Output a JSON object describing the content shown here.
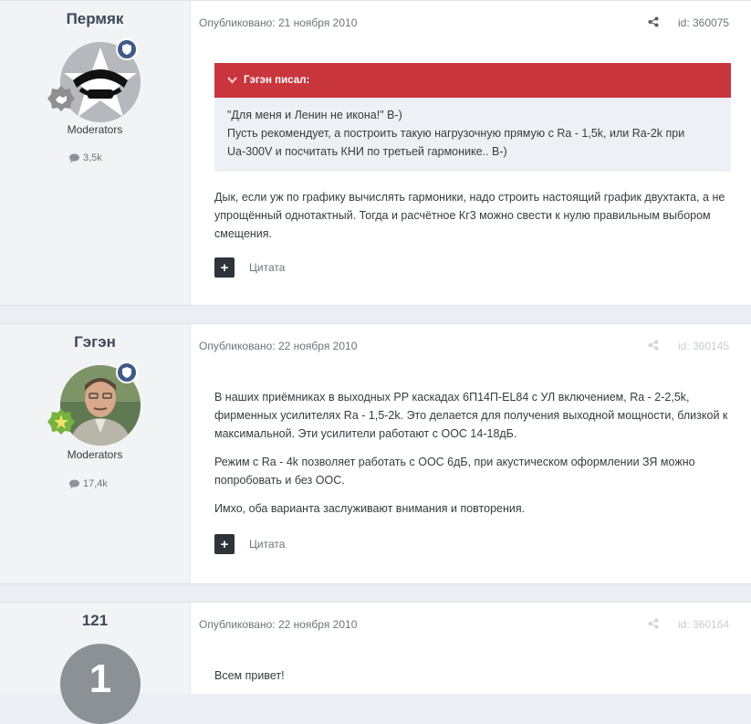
{
  "posts": [
    {
      "author": "Пермяк",
      "group": "Moderators",
      "reputation": "3,5k",
      "date_label": "Опубликовано: 21 ноября 2010",
      "id_label": "id: 360075",
      "quote": {
        "header": "Гэгэн писал:",
        "lines": [
          "\"Для меня и Ленин не икона!\" B-)",
          "Пусть рекомендует, а построить такую нагрузочную прямую с Ra - 1,5k, или Ra-2k при",
          "Ua-300V и посчитать КНИ по третьей гармонике.. B-)"
        ]
      },
      "paragraphs": [
        "Дык, если уж по графику вычислять гармоники, надо строить настоящий график двухтакта, а не упрощённый однотактный. Тогда и расчётное Кг3 можно свести к нулю правильным выбором смещения."
      ],
      "cite_label": "Цитата"
    },
    {
      "author": "Гэгэн",
      "group": "Moderators",
      "reputation": "17,4k",
      "date_label": "Опубликовано: 22 ноября 2010",
      "id_label": "id: 360145",
      "paragraphs": [
        "В наших приёмниках в выходных РР каскадах 6П14П-EL84 с УЛ включением, Ra - 2-2,5k, фирменных усилителях Ra - 1,5-2k. Это делается для получения выходной мощности, близкой к максимальной. Эти усилители работают с ООС 14-18дБ.",
        "Режим с Ra - 4k позволяет работать с ООС 6дБ, при акустическом оформлении ЗЯ можно попробовать и без ООС.",
        "Имхо, оба варианта заслуживают внимания и повторения."
      ],
      "cite_label": "Цитата"
    },
    {
      "author": "121",
      "avatar_letter": "1",
      "date_label": "Опубликовано: 22 ноября 2010",
      "id_label": "id: 360164",
      "paragraphs": [
        "Всем привет!"
      ]
    }
  ],
  "colors": {
    "quote_header": "#c8353d",
    "moderator_badge": "#3e5a88",
    "page_background": "#ebeef2"
  },
  "icons": [
    "share-icon",
    "comment-icon",
    "chevron-down-icon",
    "plus-icon",
    "shield-icon",
    "handshake-badge-icon",
    "star-badge-icon"
  ]
}
